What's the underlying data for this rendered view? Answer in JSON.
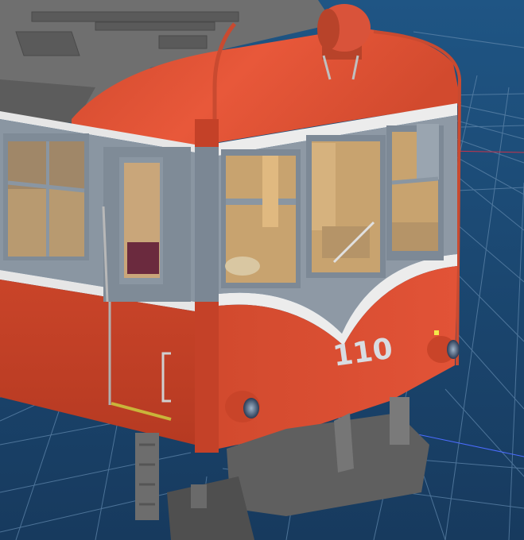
{
  "scene": {
    "car_number": "110"
  }
}
